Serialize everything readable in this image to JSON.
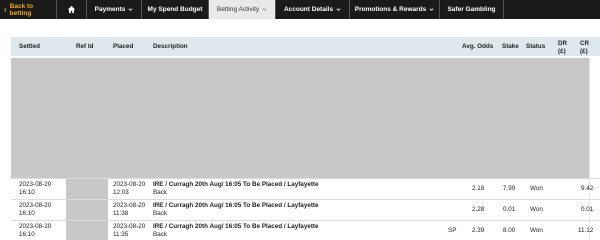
{
  "nav": {
    "back_label": "Back to betting",
    "items": [
      {
        "label": "Payments",
        "dropdown": true
      },
      {
        "label": "My Spend Budget",
        "dropdown": false
      },
      {
        "label": "Betting Activity",
        "dropdown": true,
        "active": true
      },
      {
        "label": "Account Details",
        "dropdown": true
      },
      {
        "label": "Promotions & Rewards",
        "dropdown": true
      },
      {
        "label": "Safer Gambling",
        "dropdown": false
      }
    ]
  },
  "table": {
    "headers": {
      "settled": "Settled",
      "ref_id": "Ref Id",
      "placed": "Placed",
      "description": "Description",
      "avg_odds": "Avg. Odds",
      "stake": "Stake",
      "status": "Status",
      "dr": "DR",
      "dr_unit": "(£)",
      "cr": "CR",
      "cr_unit": "(£)"
    },
    "rows": [
      {
        "settled_date": "2023-08-20",
        "settled_time": "16:10",
        "placed_date": "2023-08-20",
        "placed_time": "12:03",
        "description": "IRE / Curragh 20th Aug/ 16:05 To Be Placed / Layfayette",
        "bet_type": "Back",
        "sp": "",
        "avg_odds": "2.18",
        "stake": "7.99",
        "status": "Won",
        "dr": "",
        "cr": "9.42"
      },
      {
        "settled_date": "2023-08-20",
        "settled_time": "16:10",
        "placed_date": "2023-08-20",
        "placed_time": "11:38",
        "description": "IRE / Curragh 20th Aug/ 16:05 To Be Placed / Layfayette",
        "bet_type": "Back",
        "sp": "",
        "avg_odds": "2.28",
        "stake": "0.01",
        "status": "Won",
        "dr": "",
        "cr": "0.01"
      },
      {
        "settled_date": "2023-08-20",
        "settled_time": "16:10",
        "placed_date": "2023-08-20",
        "placed_time": "11:35",
        "description": "IRE / Curragh 20th Aug/ 16:05 To Be Placed / Layfayette",
        "bet_type": "Back",
        "sp": "SP",
        "avg_odds": "2.39",
        "stake": "8.00",
        "status": "Won",
        "dr": "",
        "cr": "11.12"
      }
    ]
  },
  "colors": {
    "nav_bg": "#1a1a1a",
    "accent": "#f6a800",
    "header_bg": "#dfe9ed",
    "redacted": "#c8c8c8"
  }
}
